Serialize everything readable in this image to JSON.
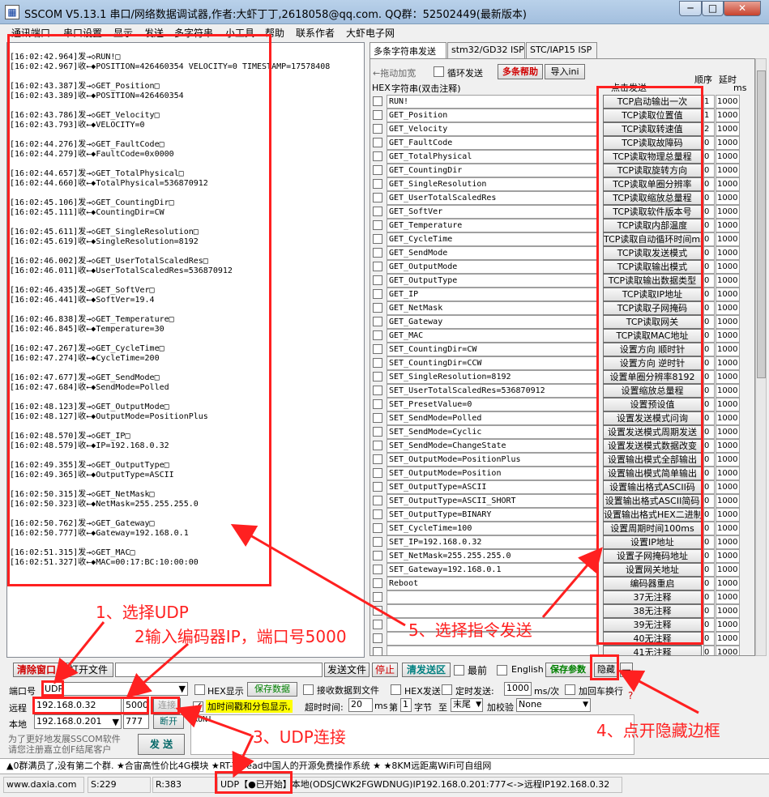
{
  "window": {
    "title": "SSCOM V5.13.1 串口/网络数据调试器,作者:大虾丁丁,2618058@qq.com. QQ群：52502449(最新版本)",
    "minimize": "─",
    "maximize": "□",
    "close": "✕"
  },
  "menu": [
    "通讯端口",
    "串口设置",
    "显示",
    "发送",
    "多字符串",
    "小工具",
    "帮助",
    "联系作者",
    "大虾电子网"
  ],
  "log": [
    "[16:02:42.964]发→◇RUN!□",
    "[16:02:42.967]收←◆POSITION=426460354 VELOCITY=0 TIMESTAMP=17578408",
    "",
    "[16:02:43.387]发→◇GET_Position□",
    "[16:02:43.389]收←◆POSITION=426460354",
    "",
    "[16:02:43.786]发→◇GET_Velocity□",
    "[16:02:43.793]收←◆VELOCITY=0",
    "",
    "[16:02:44.276]发→◇GET_FaultCode□",
    "[16:02:44.279]收←◆FaultCode=0x0000",
    "",
    "[16:02:44.657]发→◇GET_TotalPhysical□",
    "[16:02:44.660]收←◆TotalPhysical=536870912",
    "",
    "[16:02:45.106]发→◇GET_CountingDir□",
    "[16:02:45.111]收←◆CountingDir=CW",
    "",
    "[16:02:45.611]发→◇GET_SingleResolution□",
    "[16:02:45.619]收←◆SingleResolution=8192",
    "",
    "[16:02:46.002]发→◇GET_UserTotalScaledRes□",
    "[16:02:46.011]收←◆UserTotalScaledRes=536870912",
    "",
    "[16:02:46.435]发→◇GET_SoftVer□",
    "[16:02:46.441]收←◆SoftVer=19.4",
    "",
    "[16:02:46.838]发→◇GET_Temperature□",
    "[16:02:46.845]收←◆Temperature=30",
    "",
    "[16:02:47.267]发→◇GET_CycleTime□",
    "[16:02:47.274]收←◆CycleTime=200",
    "",
    "[16:02:47.677]发→◇GET_SendMode□",
    "[16:02:47.684]收←◆SendMode=Polled",
    "",
    "[16:02:48.123]发→◇GET_OutputMode□",
    "[16:02:48.127]收←◆OutputMode=PositionPlus",
    "",
    "[16:02:48.570]发→◇GET_IP□",
    "[16:02:48.579]收←◆IP=192.168.0.32",
    "",
    "[16:02:49.355]发→◇GET_OutputType□",
    "[16:02:49.365]收←◆OutputType=ASCII",
    "",
    "[16:02:50.315]发→◇GET_NetMask□",
    "[16:02:50.323]收←◆NetMask=255.255.255.0",
    "",
    "[16:02:50.762]发→◇GET_Gateway□",
    "[16:02:50.777]收←◆Gateway=192.168.0.1",
    "",
    "[16:02:51.315]发→◇GET_MAC□",
    "[16:02:51.327]收←◆MAC=00:17:BC:10:00:00"
  ],
  "tabs": [
    "多条字符串发送",
    "stm32/GD32 ISP",
    "STC/IAP15 ISP"
  ],
  "multi": {
    "drag_hint": "←拖动加宽",
    "loop_label": "循环发送",
    "help_button": "多条帮助",
    "import_button": "导入ini",
    "order_header": "顺序",
    "delay_header": "延时",
    "hex_header": "HEX",
    "string_header": "字符串(双击注释)",
    "send_header": "点击发送",
    "ms_header": "ms",
    "rows": [
      {
        "cmd": "RUN!",
        "label": "TCP启动输出一次",
        "order": "1",
        "delay": "1000"
      },
      {
        "cmd": "GET_Position",
        "label": "TCP读取位置值",
        "order": "1",
        "delay": "1000"
      },
      {
        "cmd": "GET_Velocity",
        "label": "TCP读取转速值",
        "order": "2",
        "delay": "1000"
      },
      {
        "cmd": "GET_FaultCode",
        "label": "TCP读取故障码",
        "order": "0",
        "delay": "1000"
      },
      {
        "cmd": "GET_TotalPhysical",
        "label": "TCP读取物理总量程",
        "order": "0",
        "delay": "1000"
      },
      {
        "cmd": "GET_CountingDir",
        "label": "TCP读取旋转方向",
        "order": "0",
        "delay": "1000"
      },
      {
        "cmd": "GET_SingleResolution",
        "label": "TCP读取单圈分辨率",
        "order": "0",
        "delay": "1000"
      },
      {
        "cmd": "GET_UserTotalScaledRes",
        "label": "TCP读取缩放总量程",
        "order": "0",
        "delay": "1000"
      },
      {
        "cmd": "GET_SoftVer",
        "label": "TCP读取软件版本号",
        "order": "0",
        "delay": "1000"
      },
      {
        "cmd": "GET_Temperature",
        "label": "TCP读取内部温度",
        "order": "0",
        "delay": "1000"
      },
      {
        "cmd": "GET_CycleTime",
        "label": "TCP读取自动循环时间ms",
        "order": "0",
        "delay": "1000"
      },
      {
        "cmd": "GET_SendMode",
        "label": "TCP读取发送模式",
        "order": "0",
        "delay": "1000"
      },
      {
        "cmd": "GET_OutputMode",
        "label": "TCP读取输出模式",
        "order": "0",
        "delay": "1000"
      },
      {
        "cmd": "GET_OutputType",
        "label": "TCP读取输出数据类型",
        "order": "0",
        "delay": "1000"
      },
      {
        "cmd": "GET_IP",
        "label": "TCP读取IP地址",
        "order": "0",
        "delay": "1000"
      },
      {
        "cmd": "GET_NetMask",
        "label": "TCP读取子网掩码",
        "order": "0",
        "delay": "1000"
      },
      {
        "cmd": "GET_Gateway",
        "label": "TCP读取网关",
        "order": "0",
        "delay": "1000"
      },
      {
        "cmd": "GET_MAC",
        "label": "TCP读取MAC地址",
        "order": "0",
        "delay": "1000"
      },
      {
        "cmd": "SET_CountingDir=CW",
        "label": "设置方向 顺时针",
        "order": "0",
        "delay": "1000"
      },
      {
        "cmd": "SET_CountingDir=CCW",
        "label": "设置方向 逆时针",
        "order": "0",
        "delay": "1000"
      },
      {
        "cmd": "SET_SingleResolution=8192",
        "label": "设置单圈分辨率8192",
        "order": "0",
        "delay": "1000"
      },
      {
        "cmd": "SET_UserTotalScaledRes=536870912",
        "label": "设置缩放总量程",
        "order": "0",
        "delay": "1000"
      },
      {
        "cmd": "SET_PresetValue=0",
        "label": "设置预设值",
        "order": "0",
        "delay": "1000"
      },
      {
        "cmd": "SET_SendMode=Polled",
        "label": "设置发送模式问询",
        "order": "0",
        "delay": "1000"
      },
      {
        "cmd": "SET_SendMode=Cyclic",
        "label": "设置发送模式周期发送",
        "order": "0",
        "delay": "1000"
      },
      {
        "cmd": "SET_SendMode=ChangeState",
        "label": "设置发送模式数据改变",
        "order": "0",
        "delay": "1000"
      },
      {
        "cmd": "SET_OutputMode=PositionPlus",
        "label": "设置输出模式全部输出",
        "order": "0",
        "delay": "1000"
      },
      {
        "cmd": "SET_OutputMode=Position",
        "label": "设置输出模式简单输出",
        "order": "0",
        "delay": "1000"
      },
      {
        "cmd": "SET_OutputType=ASCII",
        "label": "设置输出格式ASCII码",
        "order": "0",
        "delay": "1000"
      },
      {
        "cmd": "SET_OutputType=ASCII_SHORT",
        "label": "设置输出格式ASCII简码",
        "order": "0",
        "delay": "1000"
      },
      {
        "cmd": "SET_OutputType=BINARY",
        "label": "设置输出格式HEX二进制",
        "order": "0",
        "delay": "1000"
      },
      {
        "cmd": "SET_CycleTime=100",
        "label": "设置周期时间100ms",
        "order": "0",
        "delay": "1000"
      },
      {
        "cmd": "SET_IP=192.168.0.32",
        "label": "设置IP地址",
        "order": "0",
        "delay": "1000"
      },
      {
        "cmd": "SET_NetMask=255.255.255.0",
        "label": "设置子网掩码地址",
        "order": "0",
        "delay": "1000"
      },
      {
        "cmd": "SET_Gateway=192.168.0.1",
        "label": "设置网关地址",
        "order": "0",
        "delay": "1000"
      },
      {
        "cmd": "Reboot",
        "label": "编码器重启",
        "order": "0",
        "delay": "1000"
      },
      {
        "cmd": "",
        "label": "37无注释",
        "order": "0",
        "delay": "1000"
      },
      {
        "cmd": "",
        "label": "38无注释",
        "order": "0",
        "delay": "1000"
      },
      {
        "cmd": "",
        "label": "39无注释",
        "order": "0",
        "delay": "1000"
      },
      {
        "cmd": "",
        "label": "40无注释",
        "order": "0",
        "delay": "1000"
      },
      {
        "cmd": "",
        "label": "41无注释",
        "order": "0",
        "delay": "1000"
      }
    ]
  },
  "toolbar": {
    "clear_window": "清除窗口",
    "open_file": "打开文件",
    "send_file": "发送文件",
    "stop": "停止",
    "clear_send": "清发送区",
    "topmost": "最前",
    "english": "English",
    "save_params": "保存参数",
    "hide": "隐藏",
    "dash": "—"
  },
  "port": {
    "port_label": "端口号",
    "port_value": "UDP",
    "remote_label": "远程",
    "remote_ip": "192.168.0.32",
    "remote_port": "5000",
    "connect": "连接",
    "local_label": "本地",
    "local_ip": "192.168.0.201",
    "local_port": "777",
    "disconnect": "断开",
    "promo": "为了更好地发展SSCOM软件\n请您注册嘉立创F结尾客户"
  },
  "options": {
    "hex_display": "HEX显示",
    "save_data": "保存数据",
    "recv_to_file": "接收数据到文件",
    "hex_send": "HEX发送",
    "timed_send": "定时发送:",
    "interval": "1000",
    "interval_unit": "ms/次",
    "add_crlf": "加回车换行",
    "timestamp": "加时间戳和分包显示,",
    "timeout_label": "超时时间:",
    "timeout_value": "20",
    "timeout_unit": "ms",
    "the": "第",
    "byte_index": "1",
    "byte_label": "字节",
    "to": "至",
    "to_value": "末尾",
    "checksum_label": "加校验",
    "checksum_value": "None",
    "send_text": "RUN!",
    "send_button": "发 送",
    "question": "?"
  },
  "ticker": "▲0群满员了,没有第二个群. ★合宙高性价比4G模块 ★RT-Thread中国人的开源免费操作系统 ★ ★8KM远距离WiFi可自组网",
  "status": {
    "site": "www.daxia.com",
    "s": "S:229",
    "r": "R:383",
    "conn": "UDP【●已开始】本地(ODSJCWK2FGWDNUG)IP192.168.0.201:777<->远程IP192.168.0.32"
  },
  "annotations": {
    "step1": "1、选择UDP",
    "step2": "2输入编码器IP，端口号5000",
    "step3": "3、UDP连接",
    "step4": "4、点开隐藏边框",
    "step5": "5、选择指令发送"
  },
  "colors": {
    "annotation": "#ff2020",
    "highlight_yellow": "#ffff00",
    "green_text": "#008000"
  }
}
